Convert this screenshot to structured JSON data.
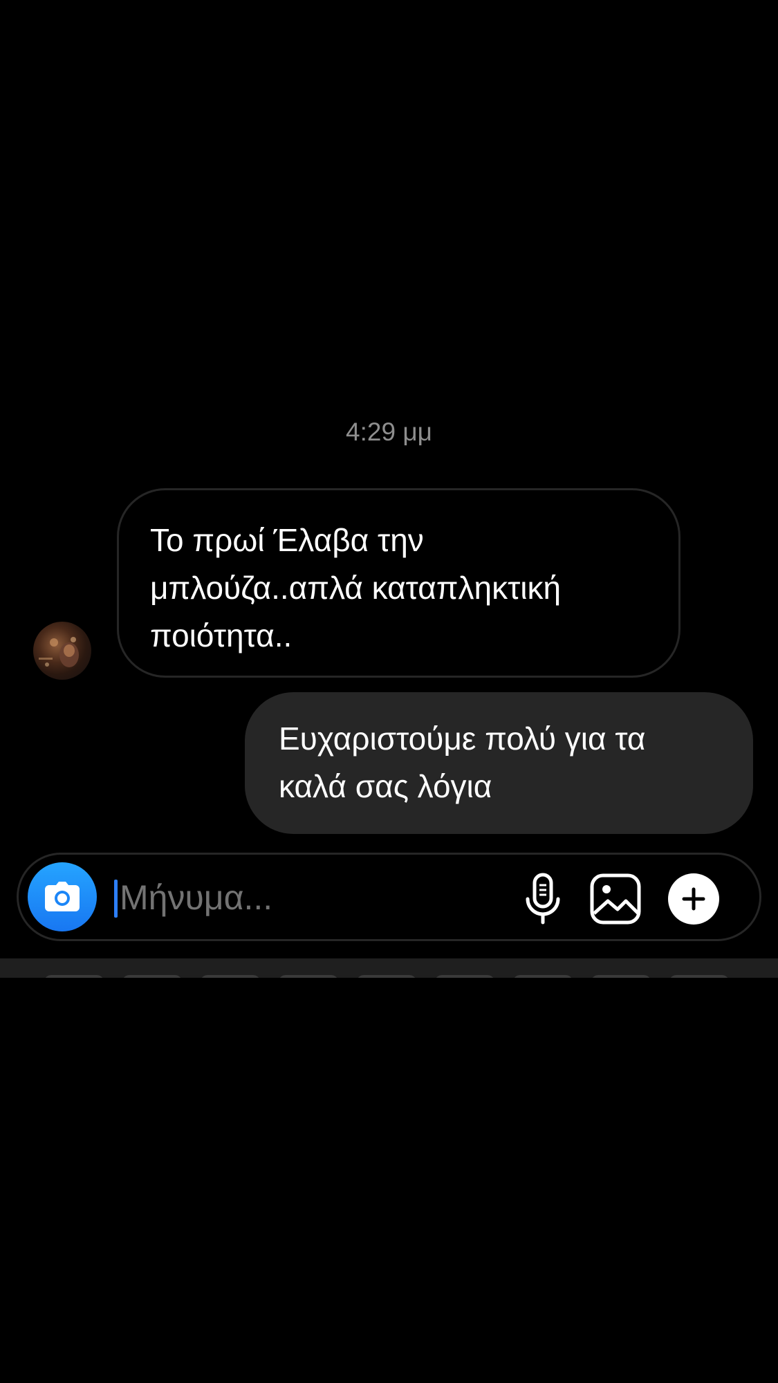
{
  "thread": {
    "timestamp": "4:29 μμ",
    "messages": [
      {
        "direction": "incoming",
        "lines": [
          "Το πρωί Έλαβα την",
          "μπλούζα..απλά καταπληκτική",
          "ποιότητα.."
        ]
      },
      {
        "direction": "outgoing",
        "lines": [
          "Ευχαριστούμε πολύ για τα",
          "καλά σας λόγια"
        ]
      }
    ]
  },
  "composer": {
    "placeholder": "Μήνυμα...",
    "value": "",
    "icons": {
      "camera": "camera-icon",
      "mic": "microphone-icon",
      "gallery": "gallery-icon",
      "plus": "plus-icon"
    }
  },
  "colors": {
    "background": "#000000",
    "outgoing_bubble": "#262626",
    "incoming_border": "#262626",
    "timestamp": "#8e8e8e",
    "camera_button": "#1877f2",
    "caret": "#2d7ff9"
  }
}
